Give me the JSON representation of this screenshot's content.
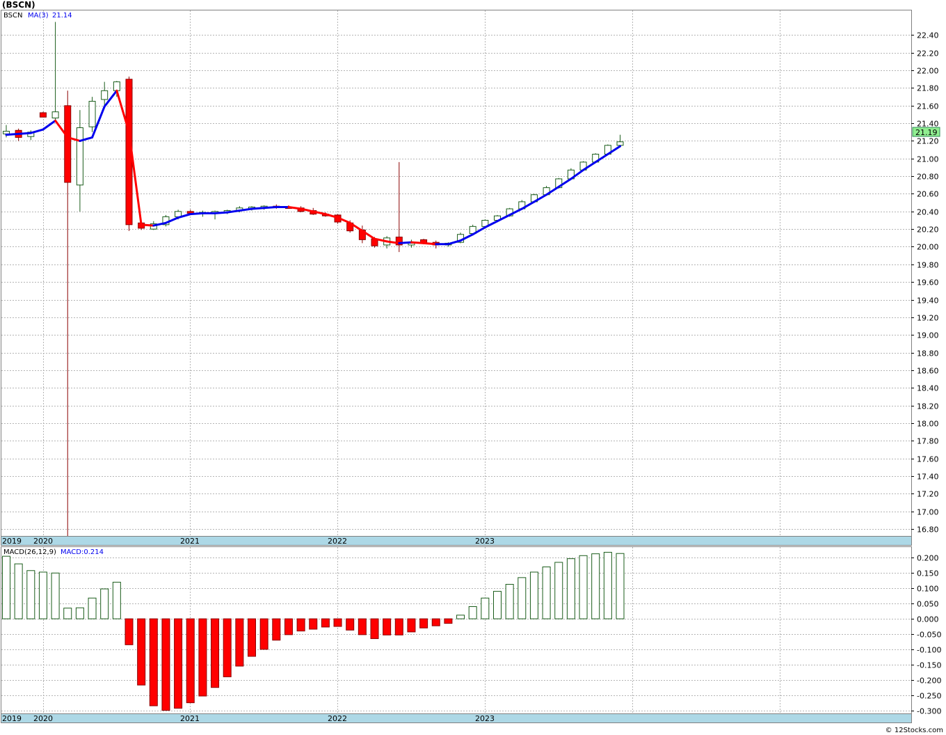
{
  "title": "(BSCN)",
  "watermark": "© 12Stocks.com",
  "colors": {
    "up_body": "#ffffff",
    "up_edge": "#1a5c1a",
    "down_body": "#ff0000",
    "down_edge": "#8b0000",
    "ma_up": "#0000ee",
    "ma_down": "#ff0000",
    "grid": "#b4b4b4",
    "band": "#add8e6",
    "last_price_bg": "#90ee90"
  },
  "price_panel": {
    "legend_ticker": "BSCN",
    "legend_ma_label": "MA(3)",
    "legend_ma_value": "21.14",
    "last_price_label": "21.19",
    "x_labels": [
      "2019",
      "2020",
      "2021",
      "2022",
      "2023"
    ]
  },
  "macd_panel": {
    "legend_label": "MACD(26,12,9)",
    "legend_value": "MACD:0.214",
    "x_labels": [
      "2019",
      "2020",
      "2021",
      "2022",
      "2023"
    ]
  },
  "chart_data": [
    {
      "type": "candlestick",
      "title": "(BSCN)",
      "period": "monthly",
      "x_ticks": [
        "2019",
        "2020",
        "2021",
        "2022",
        "2023"
      ],
      "y_ticks": [
        "16.80",
        "17.00",
        "17.20",
        "17.40",
        "17.60",
        "17.80",
        "18.00",
        "18.20",
        "18.40",
        "18.60",
        "18.80",
        "19.00",
        "19.20",
        "19.40",
        "19.60",
        "19.80",
        "20.00",
        "20.20",
        "20.40",
        "20.60",
        "20.80",
        "21.00",
        "21.20",
        "21.40",
        "21.60",
        "21.80",
        "22.00",
        "22.20",
        "22.40"
      ],
      "ylim": [
        16.72,
        22.68
      ],
      "grid": true,
      "candles": [
        {
          "o": 21.28,
          "h": 21.38,
          "l": 21.24,
          "c": 21.31
        },
        {
          "o": 21.32,
          "h": 21.34,
          "l": 21.2,
          "c": 21.24
        },
        {
          "o": 21.25,
          "h": 21.32,
          "l": 21.21,
          "c": 21.3
        },
        {
          "o": 21.52,
          "h": 21.53,
          "l": 21.47,
          "c": 21.47
        },
        {
          "o": 21.46,
          "h": 22.55,
          "l": 21.44,
          "c": 21.53
        },
        {
          "o": 21.6,
          "h": 21.77,
          "l": 16.72,
          "c": 20.73
        },
        {
          "o": 20.7,
          "h": 21.55,
          "l": 20.4,
          "c": 21.35
        },
        {
          "o": 21.36,
          "h": 21.7,
          "l": 21.3,
          "c": 21.65
        },
        {
          "o": 21.67,
          "h": 21.87,
          "l": 21.6,
          "c": 21.77
        },
        {
          "o": 21.77,
          "h": 21.88,
          "l": 21.7,
          "c": 21.87
        },
        {
          "o": 21.9,
          "h": 21.93,
          "l": 20.18,
          "c": 20.25
        },
        {
          "o": 20.27,
          "h": 20.29,
          "l": 20.19,
          "c": 20.21
        },
        {
          "o": 20.2,
          "h": 20.29,
          "l": 20.19,
          "c": 20.26
        },
        {
          "o": 20.25,
          "h": 20.36,
          "l": 20.23,
          "c": 20.34
        },
        {
          "o": 20.34,
          "h": 20.42,
          "l": 20.31,
          "c": 20.4
        },
        {
          "o": 20.4,
          "h": 20.42,
          "l": 20.36,
          "c": 20.38
        },
        {
          "o": 20.38,
          "h": 20.41,
          "l": 20.34,
          "c": 20.39
        },
        {
          "o": 20.39,
          "h": 20.41,
          "l": 20.31,
          "c": 20.4
        },
        {
          "o": 20.4,
          "h": 20.42,
          "l": 20.37,
          "c": 20.41
        },
        {
          "o": 20.41,
          "h": 20.46,
          "l": 20.39,
          "c": 20.44
        },
        {
          "o": 20.43,
          "h": 20.46,
          "l": 20.41,
          "c": 20.45
        },
        {
          "o": 20.44,
          "h": 20.47,
          "l": 20.42,
          "c": 20.46
        },
        {
          "o": 20.46,
          "h": 20.48,
          "l": 20.43,
          "c": 20.45
        },
        {
          "o": 20.45,
          "h": 20.47,
          "l": 20.43,
          "c": 20.44
        },
        {
          "o": 20.44,
          "h": 20.46,
          "l": 20.39,
          "c": 20.4
        },
        {
          "o": 20.41,
          "h": 20.44,
          "l": 20.36,
          "c": 20.37
        },
        {
          "o": 20.37,
          "h": 20.39,
          "l": 20.34,
          "c": 20.35
        },
        {
          "o": 20.36,
          "h": 20.37,
          "l": 20.26,
          "c": 20.28
        },
        {
          "o": 20.27,
          "h": 20.3,
          "l": 20.16,
          "c": 20.18
        },
        {
          "o": 20.19,
          "h": 20.24,
          "l": 20.04,
          "c": 20.08
        },
        {
          "o": 20.09,
          "h": 20.11,
          "l": 19.99,
          "c": 20.01
        },
        {
          "o": 20.02,
          "h": 20.12,
          "l": 19.98,
          "c": 20.1
        },
        {
          "o": 20.11,
          "h": 20.96,
          "l": 19.94,
          "c": 20.02
        },
        {
          "o": 20.02,
          "h": 20.08,
          "l": 19.99,
          "c": 20.04
        },
        {
          "o": 20.08,
          "h": 20.09,
          "l": 20.03,
          "c": 20.04
        },
        {
          "o": 20.05,
          "h": 20.07,
          "l": 19.98,
          "c": 20.02
        },
        {
          "o": 20.02,
          "h": 20.05,
          "l": 20.0,
          "c": 20.04
        },
        {
          "o": 20.05,
          "h": 20.16,
          "l": 20.04,
          "c": 20.14
        },
        {
          "o": 20.15,
          "h": 20.25,
          "l": 20.14,
          "c": 20.23
        },
        {
          "o": 20.23,
          "h": 20.31,
          "l": 20.21,
          "c": 20.3
        },
        {
          "o": 20.3,
          "h": 20.36,
          "l": 20.29,
          "c": 20.35
        },
        {
          "o": 20.35,
          "h": 20.44,
          "l": 20.34,
          "c": 20.43
        },
        {
          "o": 20.43,
          "h": 20.53,
          "l": 20.42,
          "c": 20.51
        },
        {
          "o": 20.51,
          "h": 20.6,
          "l": 20.5,
          "c": 20.59
        },
        {
          "o": 20.59,
          "h": 20.69,
          "l": 20.58,
          "c": 20.67
        },
        {
          "o": 20.67,
          "h": 20.78,
          "l": 20.66,
          "c": 20.77
        },
        {
          "o": 20.77,
          "h": 20.89,
          "l": 20.76,
          "c": 20.87
        },
        {
          "o": 20.87,
          "h": 20.97,
          "l": 20.86,
          "c": 20.96
        },
        {
          "o": 20.96,
          "h": 21.06,
          "l": 20.95,
          "c": 21.05
        },
        {
          "o": 21.05,
          "h": 21.16,
          "l": 21.04,
          "c": 21.15
        },
        {
          "o": 21.15,
          "h": 21.27,
          "l": 21.14,
          "c": 21.19
        }
      ],
      "ma3": [
        21.27,
        21.28,
        21.29,
        21.33,
        21.43,
        21.24,
        21.2,
        21.24,
        21.59,
        21.77,
        21.3,
        20.25,
        20.24,
        20.27,
        20.33,
        20.37,
        20.38,
        20.38,
        20.39,
        20.41,
        20.43,
        20.44,
        20.45,
        20.45,
        20.43,
        20.4,
        20.37,
        20.33,
        20.27,
        20.18,
        20.09,
        20.06,
        20.04,
        20.05,
        20.04,
        20.03,
        20.03,
        20.07,
        20.14,
        20.22,
        20.29,
        20.36,
        20.43,
        20.51,
        20.59,
        20.68,
        20.77,
        20.87,
        20.96,
        21.05,
        21.14
      ]
    },
    {
      "type": "bar",
      "title": "MACD(26,12,9)",
      "y_ticks": [
        "-0.300",
        "-0.250",
        "-0.200",
        "-0.150",
        "-0.100",
        "-0.050",
        "0.000",
        "0.050",
        "0.100",
        "0.150",
        "0.200"
      ],
      "ylim": [
        -0.31,
        0.235
      ],
      "values": [
        0.205,
        0.18,
        0.158,
        0.153,
        0.15,
        0.035,
        0.036,
        0.068,
        0.098,
        0.12,
        -0.085,
        -0.217,
        -0.285,
        -0.3,
        -0.293,
        -0.275,
        -0.253,
        -0.225,
        -0.19,
        -0.155,
        -0.123,
        -0.1,
        -0.07,
        -0.052,
        -0.04,
        -0.034,
        -0.027,
        -0.025,
        -0.037,
        -0.052,
        -0.065,
        -0.053,
        -0.053,
        -0.043,
        -0.03,
        -0.023,
        -0.015,
        0.012,
        0.04,
        0.068,
        0.09,
        0.113,
        0.135,
        0.153,
        0.17,
        0.185,
        0.197,
        0.207,
        0.213,
        0.218,
        0.214
      ]
    }
  ]
}
